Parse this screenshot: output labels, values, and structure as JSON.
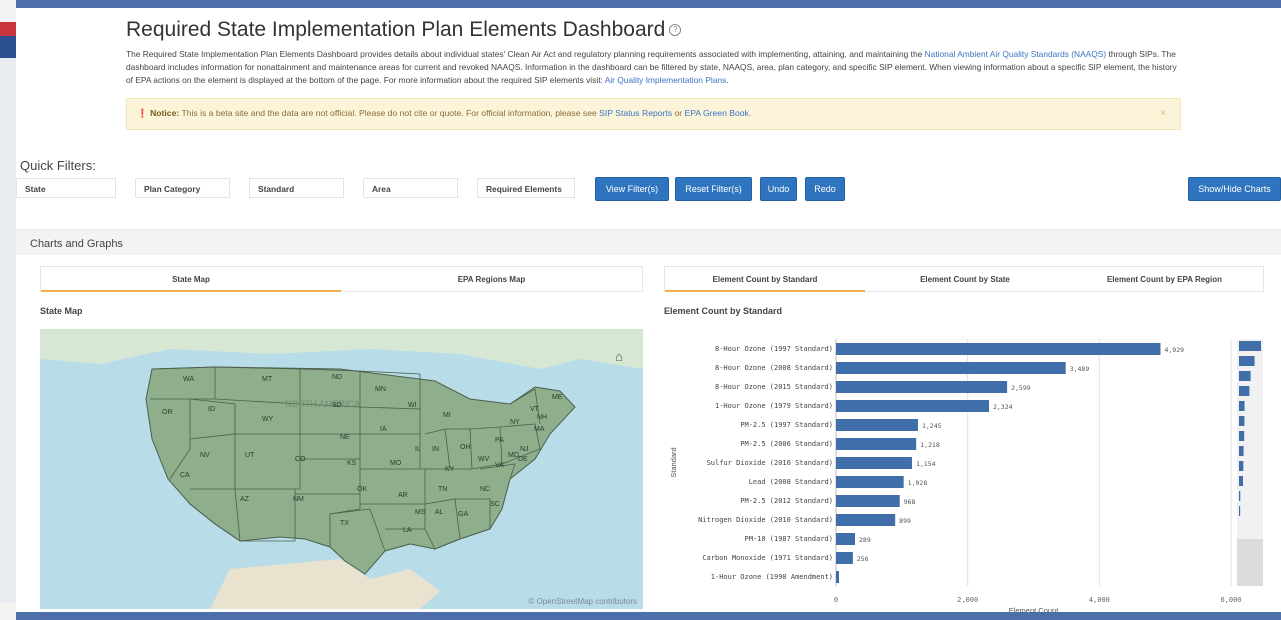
{
  "header": {
    "title": "Required State Implementation Plan Elements Dashboard",
    "intro_part1": "The Required State Implementation Plan Elements Dashboard provides details about individual states' Clean Air Act and regulatory planning requirements associated with implementing, attaining, and maintaining the ",
    "intro_link1": "National Ambient Air Quality Standards (NAAQS)",
    "intro_part2": " through SIPs. The dashboard includes information for nonattainment and maintenance areas for current and revoked NAAQS. Information in the dashboard can be filtered by state, NAAQS, area, plan category, and specific SIP element. When viewing information about a specific SIP element, the history of EPA actions on the element is displayed at the bottom of the page. For more information about the required SIP elements visit: ",
    "intro_link2": "Air Quality Implementation Plans",
    "intro_part3": "."
  },
  "notice": {
    "label": "Notice:",
    "text": " This is a beta site and the data are not official. Please do not cite or quote. For official information, please see ",
    "link1": "SIP Status Reports",
    "or": " or ",
    "link2": "EPA Green Book",
    "end": "."
  },
  "filters": {
    "label": "Quick Filters:",
    "items": [
      "State",
      "Plan Category",
      "Standard",
      "Area",
      "Required Elements"
    ]
  },
  "buttons": {
    "view": "View Filter(s)",
    "reset": "Reset Filter(s)",
    "undo": "Undo",
    "redo": "Redo",
    "showhide": "Show/Hide Charts"
  },
  "charts_section": "Charts and Graphs",
  "map_panel": {
    "tabs": [
      "State Map",
      "EPA Regions Map"
    ],
    "title": "State Map",
    "attribution": "© OpenStreetMap contributors",
    "watermark": "NORTH AMERICA",
    "states": [
      "WA",
      "MT",
      "ND",
      "MN",
      "OR",
      "ID",
      "SD",
      "WI",
      "MI",
      "WY",
      "NE",
      "IA",
      "NY",
      "VT",
      "ME",
      "NH",
      "MA",
      "PA",
      "NJ",
      "NV",
      "UT",
      "CO",
      "KS",
      "MO",
      "IL",
      "IN",
      "OH",
      "WV",
      "VA",
      "MD",
      "DE",
      "KY",
      "CA",
      "AZ",
      "NM",
      "OK",
      "AR",
      "TN",
      "NC",
      "SC",
      "MS",
      "AL",
      "GA",
      "TX",
      "LA"
    ]
  },
  "chart_panel": {
    "tabs": [
      "Element Count by Standard",
      "Element Count by State",
      "Element Count by EPA Region"
    ],
    "title": "Element Count by Standard"
  },
  "chart_data": {
    "type": "bar",
    "orientation": "horizontal",
    "categories": [
      "8-Hour Ozone (1997 Standard)",
      "8-Hour Ozone (2008 Standard)",
      "8-Hour Ozone (2015 Standard)",
      "1-Hour Ozone (1979 Standard)",
      "PM-2.5 (1997 Standard)",
      "PM-2.5 (2006 Standard)",
      "Sulfur Dioxide (2010 Standard)",
      "Lead (2008 Standard)",
      "PM-2.5 (2012 Standard)",
      "Nitrogen Dioxide (2010 Standard)",
      "PM-10 (1987 Standard)",
      "Carbon Monoxide (1971 Standard)",
      "1-Hour Ozone (1990 Amendment)"
    ],
    "values": [
      4929,
      3489,
      2599,
      2324,
      1245,
      1218,
      1154,
      1028,
      968,
      899,
      289,
      256,
      0
    ],
    "value_labels": [
      "4,929",
      "3,489",
      "2,599",
      "2,324",
      "1,245",
      "1,218",
      "1,154",
      "1,028",
      "968",
      "899",
      "289",
      "256",
      ""
    ],
    "xlabel": "Element Count",
    "ylabel": "Standard",
    "xticks": [
      "0",
      "2,000",
      "4,000",
      "6,000"
    ],
    "xlim": [
      0,
      6000
    ],
    "bar_color": "#3f6ea8",
    "grid": true
  }
}
